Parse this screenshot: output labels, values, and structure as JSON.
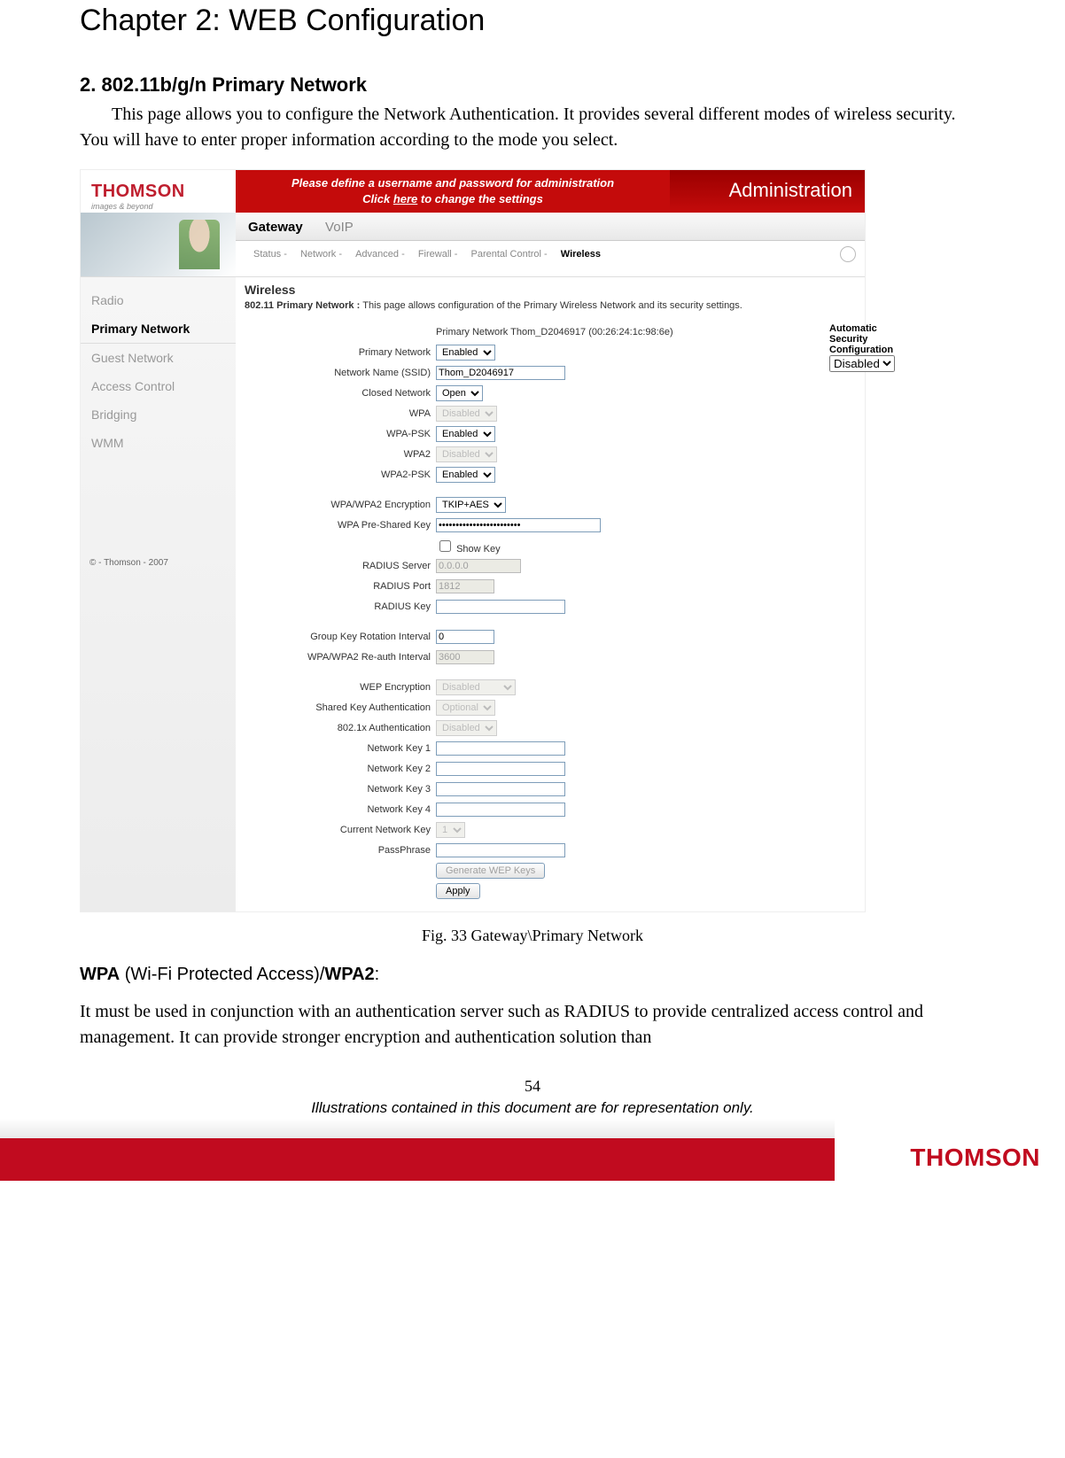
{
  "chapter_title": "Chapter 2: WEB Configuration",
  "section_title": "2. 802.11b/g/n Primary Network",
  "intro_text": "This page allows you to configure the Network Authentication. It provides several different modes of wireless security. You will have to enter proper information according to the mode you select.",
  "caption": "Fig. 33 Gateway\\Primary Network",
  "sub_wpa_b1": "WPA",
  "sub_wpa_mid": " (Wi-Fi Protected Access)/",
  "sub_wpa_b2": "WPA2",
  "sub_wpa_end": ":",
  "wpa_para": "It must be used in conjunction with an authentication server such as RADIUS to provide centralized access control and management. It can provide stronger encryption and authentication solution than",
  "page_number": "54",
  "footer_note": "Illustrations contained in this document are for representation only.",
  "footer_brand": "THOMSON",
  "shot": {
    "logo_brand": "THOMSON",
    "logo_tag": "images & beyond",
    "redbar_line1": "Please define a username and password for administration",
    "redbar_click": "Click ",
    "redbar_here": "here",
    "redbar_line2b": " to change the settings",
    "admin_title": "Administration",
    "tabs": {
      "gateway": "Gateway",
      "voip": "VoIP"
    },
    "subnav": {
      "items": [
        "Status -",
        "Network -",
        "Advanced -",
        "Firewall -",
        "Parental Control -"
      ],
      "active": "Wireless"
    },
    "sidebar": {
      "items": [
        "Radio",
        "Primary Network",
        "Guest Network",
        "Access Control",
        "Bridging",
        "WMM"
      ],
      "active_index": 1,
      "copyright": "© - Thomson - 2007"
    },
    "main": {
      "heading": "Wireless",
      "desc_label": "802.11 Primary Network  : ",
      "desc_text": "This page allows configuration of the Primary Wireless Network and its security settings.",
      "mac_line": "Primary Network Thom_D2046917 (00:26:24:1c:98:6e)",
      "auto_sec_label": "Automatic Security Configuration",
      "auto_sec_value": "Disabled",
      "rows": {
        "primary_network": {
          "label": "Primary Network",
          "value": "Enabled"
        },
        "ssid": {
          "label": "Network Name (SSID)",
          "value": "Thom_D2046917"
        },
        "closed": {
          "label": "Closed Network",
          "value": "Open"
        },
        "wpa": {
          "label": "WPA",
          "value": "Disabled"
        },
        "wpa_psk": {
          "label": "WPA-PSK",
          "value": "Enabled"
        },
        "wpa2": {
          "label": "WPA2",
          "value": "Disabled"
        },
        "wpa2_psk": {
          "label": "WPA2-PSK",
          "value": "Enabled"
        },
        "enc": {
          "label": "WPA/WPA2 Encryption",
          "value": "TKIP+AES"
        },
        "psk": {
          "label": "WPA Pre-Shared Key",
          "value": "••••••••••••••••••••••••"
        },
        "showkey": {
          "label": "Show Key"
        },
        "radius_server": {
          "label": "RADIUS Server",
          "value": "0.0.0.0"
        },
        "radius_port": {
          "label": "RADIUS Port",
          "value": "1812"
        },
        "radius_key": {
          "label": "RADIUS Key",
          "value": ""
        },
        "gkri": {
          "label": "Group Key Rotation Interval",
          "value": "0"
        },
        "reauth": {
          "label": "WPA/WPA2 Re-auth Interval",
          "value": "3600"
        },
        "wep": {
          "label": "WEP Encryption",
          "value": "Disabled"
        },
        "ska": {
          "label": "Shared Key Authentication",
          "value": "Optional"
        },
        "dot1x": {
          "label": "802.1x Authentication",
          "value": "Disabled"
        },
        "nk1": {
          "label": "Network Key 1",
          "value": ""
        },
        "nk2": {
          "label": "Network Key 2",
          "value": ""
        },
        "nk3": {
          "label": "Network Key 3",
          "value": ""
        },
        "nk4": {
          "label": "Network Key 4",
          "value": ""
        },
        "cnk": {
          "label": "Current Network Key",
          "value": "1"
        },
        "pass": {
          "label": "PassPhrase",
          "value": ""
        },
        "genwep": "Generate WEP Keys",
        "apply": "Apply"
      }
    }
  }
}
